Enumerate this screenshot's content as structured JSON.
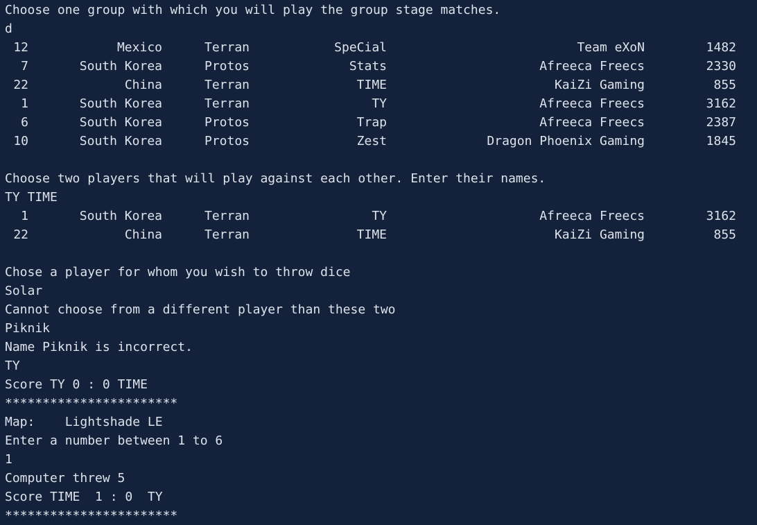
{
  "terminal": {
    "prompt_group": "Choose one group with which you will play the group stage matches.",
    "input_group": "d",
    "group_table": [
      {
        "id": "12",
        "country": "Mexico",
        "race": "Terran",
        "name": "SpeCial",
        "team": "Team eXoN",
        "elo": "1482"
      },
      {
        "id": "7",
        "country": "South Korea",
        "race": "Protos",
        "name": "Stats",
        "team": "Afreeca Freecs",
        "elo": "2330"
      },
      {
        "id": "22",
        "country": "China",
        "race": "Terran",
        "name": "TIME",
        "team": "KaiZi Gaming",
        "elo": "855"
      },
      {
        "id": "1",
        "country": "South Korea",
        "race": "Terran",
        "name": "TY",
        "team": "Afreeca Freecs",
        "elo": "3162"
      },
      {
        "id": "6",
        "country": "South Korea",
        "race": "Protos",
        "name": "Trap",
        "team": "Afreeca Freecs",
        "elo": "2387"
      },
      {
        "id": "10",
        "country": "South Korea",
        "race": "Protos",
        "name": "Zest",
        "team": "Dragon Phoenix Gaming",
        "elo": "1845"
      }
    ],
    "prompt_players": "Choose two players that will play against each other. Enter their names.",
    "input_players": "TY TIME",
    "selected_table": [
      {
        "id": "1",
        "country": "South Korea",
        "race": "Terran",
        "name": "TY",
        "team": "Afreeca Freecs",
        "elo": "3162"
      },
      {
        "id": "22",
        "country": "China",
        "race": "Terran",
        "name": "TIME",
        "team": "KaiZi Gaming",
        "elo": "855"
      }
    ],
    "prompt_dice": "Chose a player for whom you wish to throw dice",
    "input_solar": "Solar",
    "error_different": "Cannot choose from a different player than these two",
    "input_piknik": "Piknik",
    "error_incorrect": "Name Piknik is incorrect.",
    "input_ty": "TY",
    "score_initial": "Score TY 0 : 0 TIME",
    "separator_1": "***********************",
    "map_line": "Map:    Lightshade LE",
    "prompt_number": "Enter a number between 1 to 6",
    "input_number": "1",
    "computer_threw": "Computer threw 5",
    "score_update": "Score TIME  1 : 0  TY",
    "separator_2": "***********************"
  }
}
